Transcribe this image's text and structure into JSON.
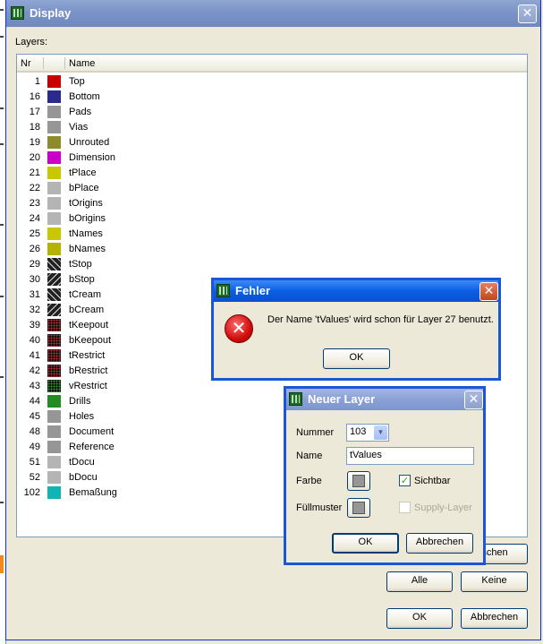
{
  "main": {
    "title": "Display",
    "layers_label": "Layers:",
    "columns": {
      "nr": "Nr",
      "name": "Name"
    },
    "layers": [
      {
        "nr": "1",
        "name": "Top",
        "color": "#c80000",
        "pattern": "solid"
      },
      {
        "nr": "16",
        "name": "Bottom",
        "color": "#2a2a8c",
        "pattern": "solid"
      },
      {
        "nr": "17",
        "name": "Pads",
        "color": "#969696",
        "pattern": "solid"
      },
      {
        "nr": "18",
        "name": "Vias",
        "color": "#969696",
        "pattern": "solid"
      },
      {
        "nr": "19",
        "name": "Unrouted",
        "color": "#8c8c28",
        "pattern": "solid"
      },
      {
        "nr": "20",
        "name": "Dimension",
        "color": "#c800c8",
        "pattern": "solid"
      },
      {
        "nr": "21",
        "name": "tPlace",
        "color": "#c8c800",
        "pattern": "solid"
      },
      {
        "nr": "22",
        "name": "bPlace",
        "color": "#b4b4b4",
        "pattern": "solid"
      },
      {
        "nr": "23",
        "name": "tOrigins",
        "color": "#b4b4b4",
        "pattern": "solid"
      },
      {
        "nr": "24",
        "name": "bOrigins",
        "color": "#b4b4b4",
        "pattern": "solid"
      },
      {
        "nr": "25",
        "name": "tNames",
        "color": "#c8c800",
        "pattern": "solid"
      },
      {
        "nr": "26",
        "name": "bNames",
        "color": "#b4b400",
        "pattern": "solid"
      },
      {
        "nr": "29",
        "name": "tStop",
        "color": "#222222",
        "pattern": "diag"
      },
      {
        "nr": "30",
        "name": "bStop",
        "color": "#222222",
        "pattern": "diag2"
      },
      {
        "nr": "31",
        "name": "tCream",
        "color": "#222222",
        "pattern": "diag"
      },
      {
        "nr": "32",
        "name": "bCream",
        "color": "#222222",
        "pattern": "diag2"
      },
      {
        "nr": "39",
        "name": "tKeepout",
        "color": "#111111",
        "pattern": "dots"
      },
      {
        "nr": "40",
        "name": "bKeepout",
        "color": "#111111",
        "pattern": "dots"
      },
      {
        "nr": "41",
        "name": "tRestrict",
        "color": "#111111",
        "pattern": "dots"
      },
      {
        "nr": "42",
        "name": "bRestrict",
        "color": "#111111",
        "pattern": "dots"
      },
      {
        "nr": "43",
        "name": "vRestrict",
        "color": "#111111",
        "pattern": "dots2"
      },
      {
        "nr": "44",
        "name": "Drills",
        "color": "#228b22",
        "pattern": "solid"
      },
      {
        "nr": "45",
        "name": "Holes",
        "color": "#969696",
        "pattern": "solid"
      },
      {
        "nr": "48",
        "name": "Document",
        "color": "#969696",
        "pattern": "solid"
      },
      {
        "nr": "49",
        "name": "Reference",
        "color": "#969696",
        "pattern": "solid"
      },
      {
        "nr": "51",
        "name": "tDocu",
        "color": "#b4b4b4",
        "pattern": "solid"
      },
      {
        "nr": "52",
        "name": "bDocu",
        "color": "#b4b4b4",
        "pattern": "solid"
      },
      {
        "nr": "102",
        "name": "Bemaßung",
        "color": "#10b4b4",
        "pattern": "solid"
      }
    ],
    "hidden_button_label": "schen",
    "all_label": "Alle",
    "none_label": "Keine",
    "ok_label": "OK",
    "cancel_label": "Abbrechen"
  },
  "error_dialog": {
    "title": "Fehler",
    "message": "Der Name 'tValues' wird schon für Layer 27 benutzt.",
    "ok_label": "OK"
  },
  "new_layer_dialog": {
    "title": "Neuer Layer",
    "number_label": "Nummer",
    "number_value": "103",
    "name_label": "Name",
    "name_value": "tValues",
    "color_label": "Farbe",
    "fill_label": "Füllmuster",
    "visible_label": "Sichtbar",
    "visible_checked": true,
    "supply_label": "Supply-Layer",
    "supply_checked": false,
    "ok_label": "OK",
    "cancel_label": "Abbrechen",
    "swatch_color": "#969696"
  },
  "colors": {
    "xp_blue": "#0a5ee3",
    "inactive_title": "#7b93c8"
  }
}
